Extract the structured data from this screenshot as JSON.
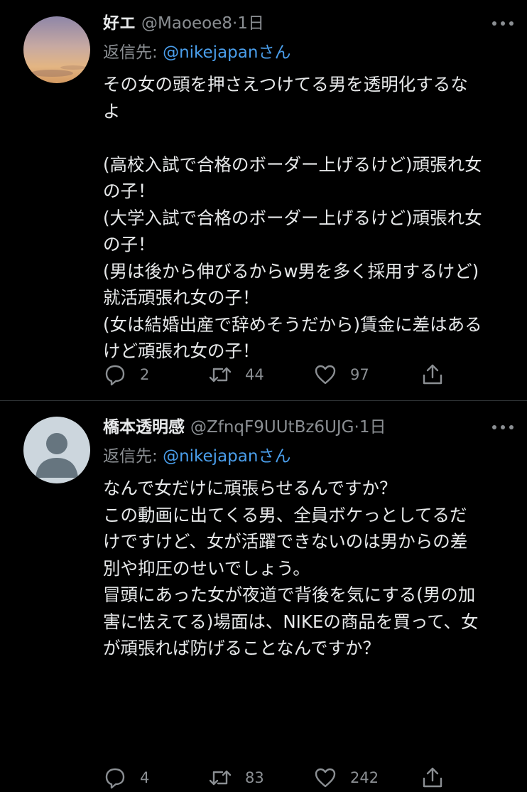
{
  "tweets": [
    {
      "display_name": "好エ",
      "handle": "@Maoeoe8",
      "separator": "·",
      "time": "1日",
      "reply_prefix": "返信先: ",
      "reply_mention": "@nikejapan",
      "reply_suffix": "さん",
      "body": "その女の頭を押さえつけてる男を透明化するな\nよ\n\n(高校入試で合格のボーダー上げるけど)頑張れ女\nの子！\n(大学入試で合格のボーダー上げるけど)頑張れ女\nの子！\n(男は後から伸びるからw男を多く採用するけど)\n就活頑張れ女の子！\n(女は結婚出産で辞めそうだから)賃金に差はある\nけど頑張れ女の子！",
      "replies": "2",
      "retweets": "44",
      "likes": "97",
      "avatar": "sunset-photo"
    },
    {
      "display_name": "橋本透明感",
      "handle": "@ZfnqF9UUtBz6UJG",
      "separator": "·",
      "time": "1日",
      "reply_prefix": "返信先: ",
      "reply_mention": "@nikejapan",
      "reply_suffix": "さん",
      "body": "なんで女だけに頑張らせるんですか？\nこの動画に出てくる男、全員ボケっとしてるだ\nけですけど、女が活躍できないのは男からの差\n別や抑圧のせいでしょう。\n冒頭にあった女が夜道で背後を気にする(男の加\n害に怯えてる)場面は、NIKEの商品を買って、女\nが頑張れば防げることなんですか？",
      "replies": "4",
      "retweets": "83",
      "likes": "242",
      "avatar": "default-avatar"
    }
  ],
  "icons": {
    "more": "more-icon",
    "reply": "reply-icon",
    "retweet": "retweet-icon",
    "like": "heart-icon",
    "share": "share-icon"
  },
  "colors": {
    "background": "#000000",
    "text": "#e7e9ea",
    "secondary": "#8b8f93",
    "mention": "#4a9eeb",
    "divider": "#2f3336"
  }
}
